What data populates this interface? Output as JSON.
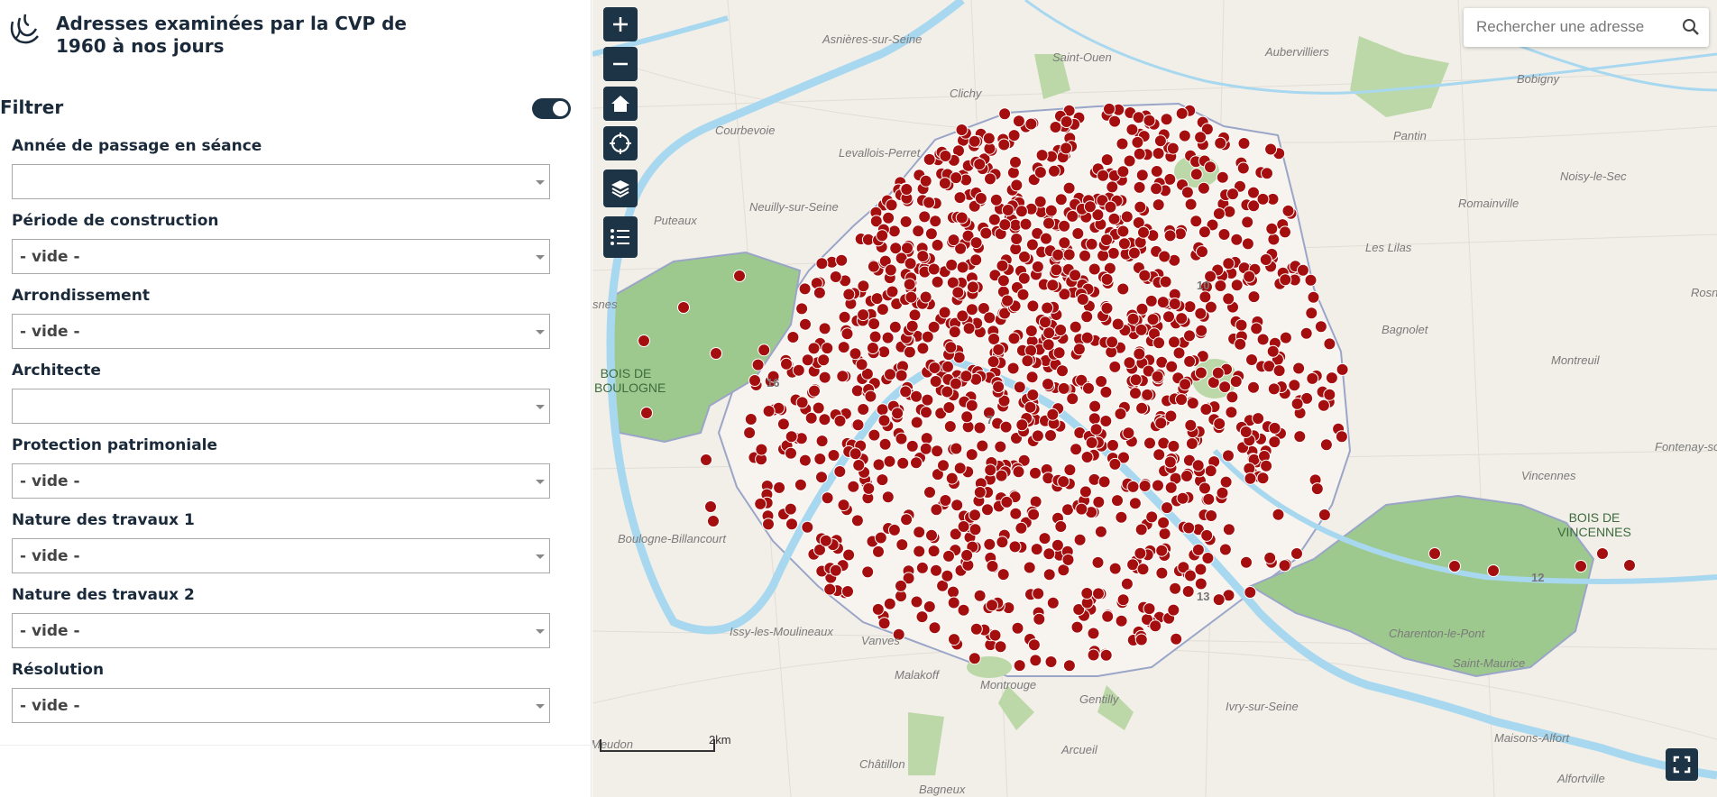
{
  "sidebar": {
    "title": "Adresses examinées par la CVP de 1960 à nos jours",
    "filter_label": "Filtrer",
    "filter_enabled": true,
    "fields": [
      {
        "label": "Année de passage en séance",
        "value": ""
      },
      {
        "label": "Période de construction",
        "value": "- vide -"
      },
      {
        "label": "Arrondissement",
        "value": "- vide -"
      },
      {
        "label": "Architecte",
        "value": ""
      },
      {
        "label": "Protection patrimoniale",
        "value": "- vide -"
      },
      {
        "label": "Nature des travaux 1",
        "value": "- vide -"
      },
      {
        "label": "Nature des travaux 2",
        "value": "- vide -"
      },
      {
        "label": "Résolution",
        "value": "- vide -"
      }
    ]
  },
  "map": {
    "search_placeholder": "Rechercher une adresse",
    "scale_label": "2km",
    "marker_color": "#a50e0e",
    "water_color": "#a8d8ef",
    "park_color": "#9ec98e",
    "places": [
      "Asnières-sur-Seine",
      "Saint-Ouen",
      "Aubervilliers",
      "Bobigny",
      "Clichy",
      "Pantin",
      "Courbevoie",
      "Levallois-Perret",
      "Noisy-le-Sec",
      "Neuilly-sur-Seine",
      "Romainville",
      "Puteaux",
      "Les Lilas",
      "Bagnolet",
      "Montreuil",
      "Fontenay-sous",
      "Vincennes",
      "Boulogne-Billancourt",
      "Issy-les-Moulineaux",
      "Vanves",
      "Charenton-le-Pont",
      "Saint-Maurice",
      "Malakoff",
      "Montrouge",
      "Gentilly",
      "Ivry-sur-Seine",
      "Maisons-Alfort",
      "Arcueil",
      "Meudon",
      "Châtillon",
      "Alfortville",
      "Bagneux",
      "Rosn",
      "snes"
    ],
    "parks": [
      "BOIS DE BOULOGNE",
      "BOIS DE VINCENNES"
    ],
    "arrondissements": [
      "16",
      "7",
      "10",
      "13",
      "12"
    ],
    "controls": [
      "zoom-in",
      "zoom-out",
      "home",
      "locate",
      "layers",
      "legend"
    ]
  }
}
